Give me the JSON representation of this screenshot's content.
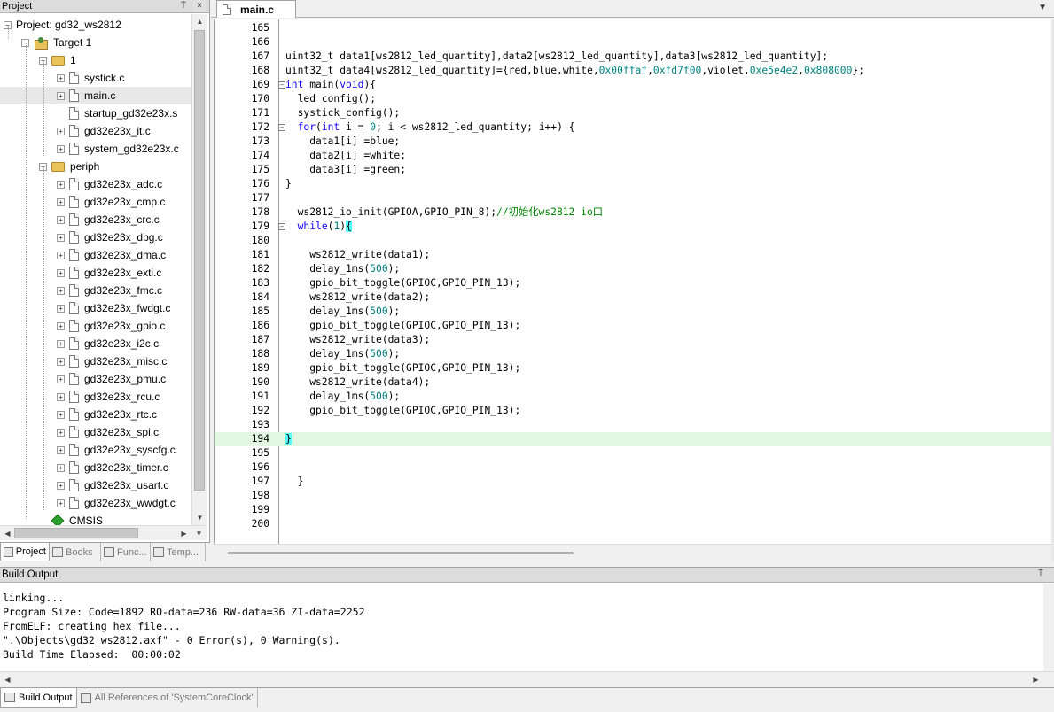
{
  "project_panel": {
    "title": "Project",
    "pin_glyph": "⍑",
    "close_glyph": "×",
    "tree": [
      {
        "label": "Project: gd32_ws2812",
        "depth": 0,
        "icon": "project-icon",
        "expander": "−",
        "selected": false
      },
      {
        "label": "Target 1",
        "depth": 1,
        "icon": "target-icon",
        "expander": "−",
        "selected": false
      },
      {
        "label": "1",
        "depth": 2,
        "icon": "folder-icon",
        "expander": "−",
        "selected": false
      },
      {
        "label": "systick.c",
        "depth": 3,
        "icon": "file-icon",
        "expander": "+",
        "selected": false
      },
      {
        "label": "main.c",
        "depth": 3,
        "icon": "file-icon",
        "expander": "+",
        "selected": true
      },
      {
        "label": "startup_gd32e23x.s",
        "depth": 3,
        "icon": "file-icon",
        "expander": "",
        "selected": false
      },
      {
        "label": "gd32e23x_it.c",
        "depth": 3,
        "icon": "file-icon",
        "expander": "+",
        "selected": false
      },
      {
        "label": "system_gd32e23x.c",
        "depth": 3,
        "icon": "file-icon",
        "expander": "+",
        "selected": false
      },
      {
        "label": "periph",
        "depth": 2,
        "icon": "folder-icon",
        "expander": "−",
        "selected": false
      },
      {
        "label": "gd32e23x_adc.c",
        "depth": 3,
        "icon": "file-icon",
        "expander": "+",
        "selected": false
      },
      {
        "label": "gd32e23x_cmp.c",
        "depth": 3,
        "icon": "file-icon",
        "expander": "+",
        "selected": false
      },
      {
        "label": "gd32e23x_crc.c",
        "depth": 3,
        "icon": "file-icon",
        "expander": "+",
        "selected": false
      },
      {
        "label": "gd32e23x_dbg.c",
        "depth": 3,
        "icon": "file-icon",
        "expander": "+",
        "selected": false
      },
      {
        "label": "gd32e23x_dma.c",
        "depth": 3,
        "icon": "file-icon",
        "expander": "+",
        "selected": false
      },
      {
        "label": "gd32e23x_exti.c",
        "depth": 3,
        "icon": "file-icon",
        "expander": "+",
        "selected": false
      },
      {
        "label": "gd32e23x_fmc.c",
        "depth": 3,
        "icon": "file-icon",
        "expander": "+",
        "selected": false
      },
      {
        "label": "gd32e23x_fwdgt.c",
        "depth": 3,
        "icon": "file-icon",
        "expander": "+",
        "selected": false
      },
      {
        "label": "gd32e23x_gpio.c",
        "depth": 3,
        "icon": "file-icon",
        "expander": "+",
        "selected": false
      },
      {
        "label": "gd32e23x_i2c.c",
        "depth": 3,
        "icon": "file-icon",
        "expander": "+",
        "selected": false
      },
      {
        "label": "gd32e23x_misc.c",
        "depth": 3,
        "icon": "file-icon",
        "expander": "+",
        "selected": false
      },
      {
        "label": "gd32e23x_pmu.c",
        "depth": 3,
        "icon": "file-icon",
        "expander": "+",
        "selected": false
      },
      {
        "label": "gd32e23x_rcu.c",
        "depth": 3,
        "icon": "file-icon",
        "expander": "+",
        "selected": false
      },
      {
        "label": "gd32e23x_rtc.c",
        "depth": 3,
        "icon": "file-icon",
        "expander": "+",
        "selected": false
      },
      {
        "label": "gd32e23x_spi.c",
        "depth": 3,
        "icon": "file-icon",
        "expander": "+",
        "selected": false
      },
      {
        "label": "gd32e23x_syscfg.c",
        "depth": 3,
        "icon": "file-icon",
        "expander": "+",
        "selected": false
      },
      {
        "label": "gd32e23x_timer.c",
        "depth": 3,
        "icon": "file-icon",
        "expander": "+",
        "selected": false
      },
      {
        "label": "gd32e23x_usart.c",
        "depth": 3,
        "icon": "file-icon",
        "expander": "+",
        "selected": false
      },
      {
        "label": "gd32e23x_wwdgt.c",
        "depth": 3,
        "icon": "file-icon",
        "expander": "+",
        "selected": false
      },
      {
        "label": "CMSIS",
        "depth": 2,
        "icon": "cmsis-icon",
        "expander": "",
        "selected": false
      }
    ],
    "tabs": [
      {
        "label": "Project",
        "icon": "project-tab-icon",
        "active": true
      },
      {
        "label": "Books",
        "icon": "books-icon",
        "active": false
      },
      {
        "label": "Func...",
        "icon": "functions-icon",
        "active": false,
        "prefix": "{}"
      },
      {
        "label": "Temp...",
        "icon": "templates-icon",
        "active": false,
        "prefix": "{}→"
      }
    ]
  },
  "editor": {
    "tab_label": "main.c",
    "tab_menu_glyph": "▼",
    "current_line": 194,
    "lines": [
      {
        "n": 165,
        "tokens": []
      },
      {
        "n": 166,
        "tokens": []
      },
      {
        "n": 167,
        "tokens": [
          {
            "t": "uint32_t data1[ws2812_led_quantity],data2[ws2812_led_quantity],data3[ws2812_led_quantity];"
          }
        ]
      },
      {
        "n": 168,
        "tokens": [
          {
            "t": "uint32_t data4[ws2812_led_quantity]={red,blue,white,"
          },
          {
            "t": "0x00ffaf",
            "c": "num"
          },
          {
            "t": ","
          },
          {
            "t": "0xfd7f00",
            "c": "num"
          },
          {
            "t": ",violet,"
          },
          {
            "t": "0xe5e4e2",
            "c": "num"
          },
          {
            "t": ","
          },
          {
            "t": "0x808000",
            "c": "num"
          },
          {
            "t": "};"
          }
        ]
      },
      {
        "n": 169,
        "fold": "−",
        "tokens": [
          {
            "t": "int",
            "c": "kw"
          },
          {
            "t": " main("
          },
          {
            "t": "void",
            "c": "kw"
          },
          {
            "t": "){"
          }
        ]
      },
      {
        "n": 170,
        "tokens": [
          {
            "t": "  led_config();"
          }
        ]
      },
      {
        "n": 171,
        "tokens": [
          {
            "t": "  systick_config();"
          }
        ]
      },
      {
        "n": 172,
        "fold": "−",
        "tokens": [
          {
            "t": "  "
          },
          {
            "t": "for",
            "c": "kw"
          },
          {
            "t": "("
          },
          {
            "t": "int",
            "c": "kw"
          },
          {
            "t": " i = "
          },
          {
            "t": "0",
            "c": "num"
          },
          {
            "t": "; i < ws2812_led_quantity; i++) {"
          }
        ]
      },
      {
        "n": 173,
        "tokens": [
          {
            "t": "    data1[i] =blue;"
          }
        ]
      },
      {
        "n": 174,
        "tokens": [
          {
            "t": "    data2[i] =white;"
          }
        ]
      },
      {
        "n": 175,
        "tokens": [
          {
            "t": "    data3[i] =green;"
          }
        ]
      },
      {
        "n": 176,
        "tokens": [
          {
            "t": "}"
          }
        ]
      },
      {
        "n": 177,
        "tokens": []
      },
      {
        "n": 178,
        "tokens": [
          {
            "t": "  ws2812_io_init(GPIOA,GPIO_PIN_8);"
          },
          {
            "t": "//初始化ws2812 io口",
            "c": "cmt"
          }
        ]
      },
      {
        "n": 179,
        "fold": "−",
        "tokens": [
          {
            "t": "  "
          },
          {
            "t": "while",
            "c": "kw"
          },
          {
            "t": "("
          },
          {
            "t": "1",
            "c": "num"
          },
          {
            "t": ")"
          },
          {
            "t": "{",
            "c": "brace-hl"
          }
        ]
      },
      {
        "n": 180,
        "tokens": []
      },
      {
        "n": 181,
        "tokens": [
          {
            "t": "    ws2812_write(data1);"
          }
        ]
      },
      {
        "n": 182,
        "tokens": [
          {
            "t": "    delay_1ms("
          },
          {
            "t": "500",
            "c": "num"
          },
          {
            "t": ");"
          }
        ]
      },
      {
        "n": 183,
        "tokens": [
          {
            "t": "    gpio_bit_toggle(GPIOC,GPIO_PIN_13);"
          }
        ]
      },
      {
        "n": 184,
        "tokens": [
          {
            "t": "    ws2812_write(data2);"
          }
        ]
      },
      {
        "n": 185,
        "tokens": [
          {
            "t": "    delay_1ms("
          },
          {
            "t": "500",
            "c": "num"
          },
          {
            "t": ");"
          }
        ]
      },
      {
        "n": 186,
        "tokens": [
          {
            "t": "    gpio_bit_toggle(GPIOC,GPIO_PIN_13);"
          }
        ]
      },
      {
        "n": 187,
        "tokens": [
          {
            "t": "    ws2812_write(data3);"
          }
        ]
      },
      {
        "n": 188,
        "tokens": [
          {
            "t": "    delay_1ms("
          },
          {
            "t": "500",
            "c": "num"
          },
          {
            "t": ");"
          }
        ]
      },
      {
        "n": 189,
        "tokens": [
          {
            "t": "    gpio_bit_toggle(GPIOC,GPIO_PIN_13);"
          }
        ]
      },
      {
        "n": 190,
        "tokens": [
          {
            "t": "    ws2812_write(data4);"
          }
        ]
      },
      {
        "n": 191,
        "tokens": [
          {
            "t": "    delay_1ms("
          },
          {
            "t": "500",
            "c": "num"
          },
          {
            "t": ");"
          }
        ]
      },
      {
        "n": 192,
        "tokens": [
          {
            "t": "    gpio_bit_toggle(GPIOC,GPIO_PIN_13);"
          }
        ]
      },
      {
        "n": 193,
        "tokens": []
      },
      {
        "n": 194,
        "tokens": [
          {
            "t": "}",
            "c": "brace-hl"
          }
        ]
      },
      {
        "n": 195,
        "tokens": []
      },
      {
        "n": 196,
        "tokens": []
      },
      {
        "n": 197,
        "tokens": [
          {
            "t": "  }"
          }
        ]
      },
      {
        "n": 198,
        "tokens": []
      },
      {
        "n": 199,
        "tokens": []
      },
      {
        "n": 200,
        "tokens": []
      }
    ]
  },
  "build_output": {
    "title": "Build Output",
    "pin_glyph": "⍑",
    "lines": [
      "linking...",
      "Program Size: Code=1892 RO-data=236 RW-data=36 ZI-data=2252",
      "FromELF: creating hex file...",
      "\".\\Objects\\gd32_ws2812.axf\" - 0 Error(s), 0 Warning(s).",
      "Build Time Elapsed:  00:00:02"
    ]
  },
  "bottom_tabs": [
    {
      "label": "Build Output",
      "icon": "build-output-icon",
      "active": true
    },
    {
      "label": "All References of 'SystemCoreClock'",
      "icon": "references-icon",
      "active": false
    }
  ],
  "scroll_glyphs": {
    "up": "▲",
    "down": "▼",
    "left": "◀",
    "right": "▶"
  }
}
